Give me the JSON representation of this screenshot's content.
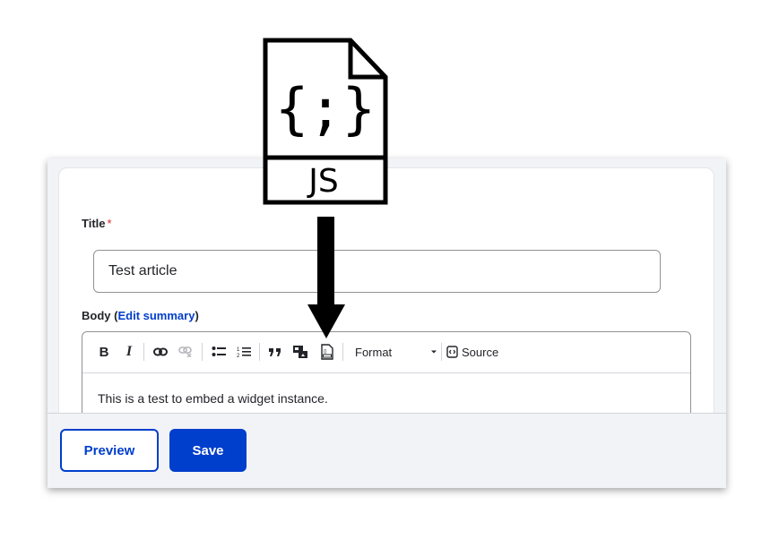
{
  "form": {
    "title_label": "Title",
    "required_mark": "*",
    "title_value": "Test article",
    "body_label": "Body",
    "body_paren_open": "(",
    "edit_summary_link": "Edit summary",
    "body_paren_close": ")",
    "body_text": "This is a test to embed a widget instance."
  },
  "toolbar": {
    "bold": "B",
    "italic": "I",
    "format_label": "Format",
    "source_label": "Source",
    "icons": [
      "bold-icon",
      "italic-icon",
      "link-icon",
      "unlink-icon",
      "bulleted-list-icon",
      "numbered-list-icon",
      "blockquote-icon",
      "media-embed-icon",
      "widget-embed-icon",
      "source-icon"
    ]
  },
  "actions": {
    "preview_label": "Preview",
    "save_label": "Save"
  },
  "overlay": {
    "file_badge_text": "JS",
    "file_glyph": "{;}",
    "file_icon": "javascript-file-icon",
    "arrow_icon": "down-arrow-icon"
  },
  "colors": {
    "accent": "#003ecc",
    "required": "#dc2323",
    "text": "#232429",
    "border": "#919297"
  }
}
